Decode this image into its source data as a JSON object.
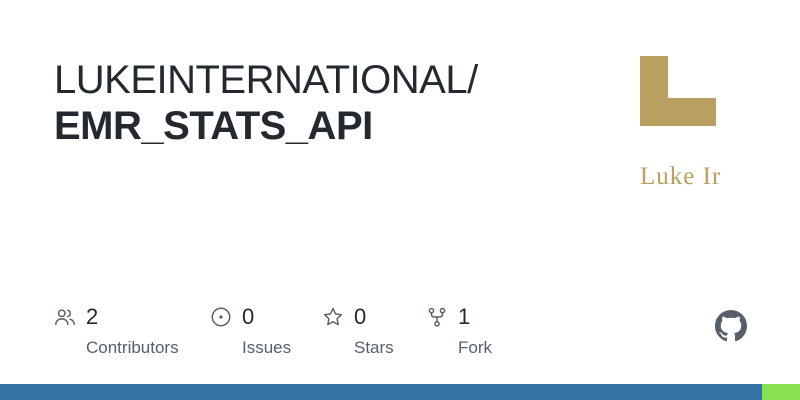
{
  "repo": {
    "owner": "LUKEINTERNATIONAL/",
    "name": "EMR_STATS_API"
  },
  "avatar": {
    "letter": "L",
    "caption": "Luke Ir",
    "color": "#b9a060"
  },
  "stats": [
    {
      "icon": "contributors-icon",
      "value": "2",
      "label": "Contributors"
    },
    {
      "icon": "issues-icon",
      "value": "0",
      "label": "Issues"
    },
    {
      "icon": "star-icon",
      "value": "0",
      "label": "Stars"
    },
    {
      "icon": "fork-icon",
      "value": "1",
      "label": "Fork"
    }
  ],
  "colors": {
    "text": "#24292f",
    "muted": "#57606a",
    "icon": "#57606a",
    "lang_primary": "#3572A5",
    "lang_secondary": "#89e051"
  },
  "language_bar": [
    {
      "color": "#3572A5",
      "fraction": 0.953
    },
    {
      "color": "#89e051",
      "fraction": 0.047
    }
  ]
}
